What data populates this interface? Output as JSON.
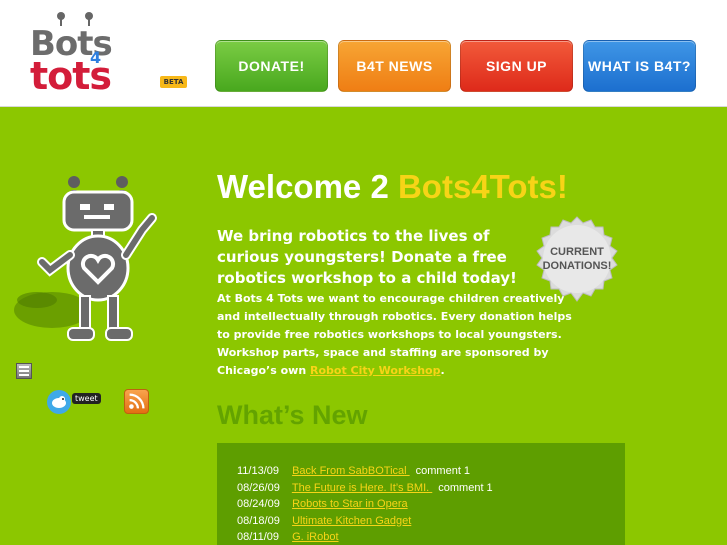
{
  "logo": {
    "line1": "Bots",
    "four": "4",
    "line2": "tots",
    "beta": "BETA"
  },
  "nav": {
    "donate": "DONATE!",
    "news": "B4T NEWS",
    "signup": "SIGN UP",
    "what": "WHAT IS B4T?"
  },
  "colors": {
    "background": "#8cc700",
    "accent": "#f7d417",
    "donate": "#5ab92c",
    "news": "#f28e1f",
    "signup": "#e63c25",
    "what": "#2b7fdb"
  },
  "sidebar": {
    "share_icon": "share-icon",
    "twitter_icon": "twitter-bird-icon",
    "tweet_label": "tweet",
    "rss_icon": "rss-icon"
  },
  "main": {
    "welcome_prefix": "Welcome 2 ",
    "welcome_accent": "Bots4Tots!",
    "intro": "We bring robotics to the lives of curious youngsters! Donate a free robotics workshop to a child today!",
    "body_before_link": "At Bots 4 Tots we want to encourage children creatively and intellectually through robotics. Every donation helps to provide free robotics workshops to local youngsters. Workshop parts, space and staffing are sponsored by Chicago’s own ",
    "body_link": "Robot City Workshop",
    "body_after_link": ".",
    "badge_line1": "CURRENT",
    "badge_line2": "DONATIONS!"
  },
  "whats_new": {
    "heading": "What’s New",
    "items": [
      {
        "date": "11/13/09",
        "title": " Back From SabBOTical ",
        "comment": "comment 1"
      },
      {
        "date": "08/26/09",
        "title": " The Future is Here. It’s BMI. ",
        "comment": "comment 1"
      },
      {
        "date": "08/24/09",
        "title": "Robots to Star in Opera",
        "comment": ""
      },
      {
        "date": "08/18/09",
        "title": " Ultimate Kitchen Gadget",
        "comment": ""
      },
      {
        "date": "08/11/09",
        "title": " G. iRobot",
        "comment": ""
      }
    ]
  }
}
